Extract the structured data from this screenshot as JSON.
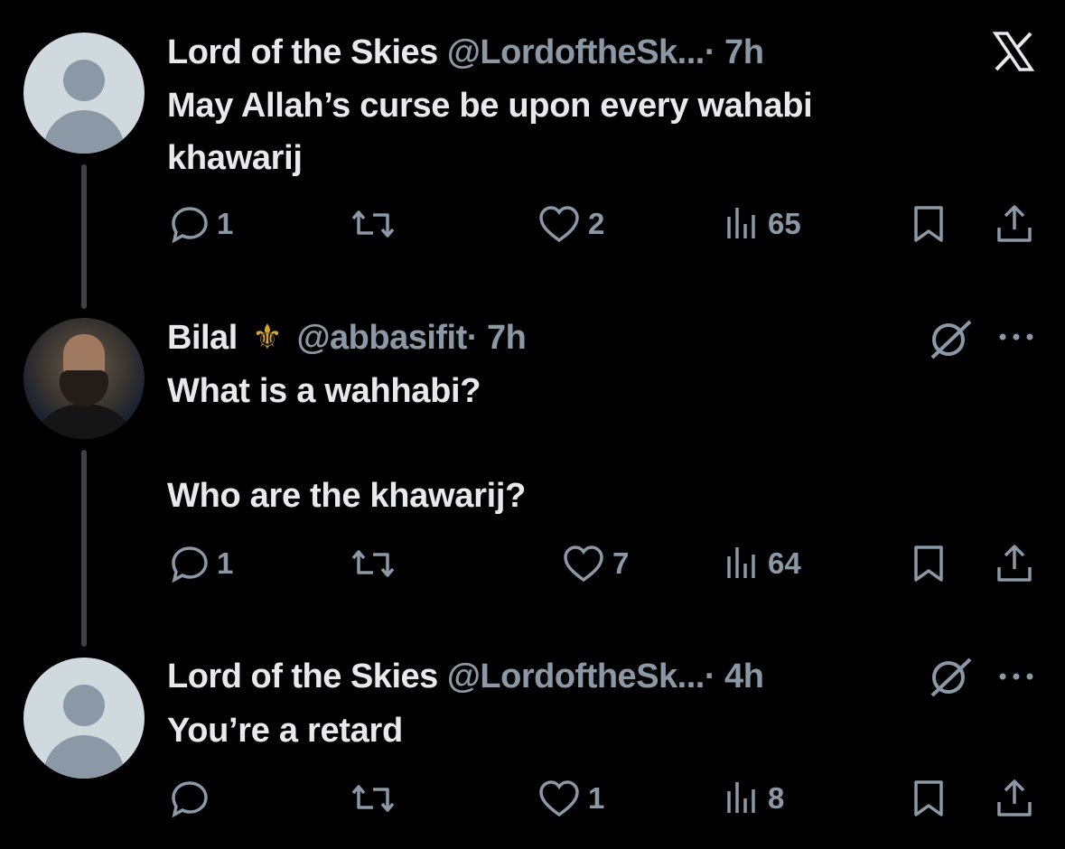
{
  "tweets": [
    {
      "name": "Lord of the Skies",
      "handle": "@LordoftheSk...",
      "time": "· 7h",
      "text_lines": [
        "May Allah’s curse be upon every wahabi",
        "khawarij"
      ],
      "replies": "1",
      "likes": "2",
      "views": "65"
    },
    {
      "name": "Bilal",
      "badge": "⚜",
      "handle": "@abbasifit",
      "time": "· 7h",
      "text_lines": [
        "What is a wahhabi?",
        "",
        "Who are the khawarij?"
      ],
      "replies": "1",
      "likes": "7",
      "views": "64"
    },
    {
      "name": "Lord of the Skies",
      "handle": "@LordoftheSk...",
      "time": "· 4h",
      "text_lines": [
        "You’re a retard"
      ],
      "replies": "",
      "likes": "1",
      "views": "8"
    }
  ],
  "icons": {
    "logo": "x-logo-icon",
    "reply": "reply-icon",
    "retweet": "retweet-icon",
    "like": "heart-icon",
    "views": "views-icon",
    "bookmark": "bookmark-icon",
    "share": "share-icon",
    "grok": "grok-icon",
    "more": "more-icon"
  },
  "colors": {
    "background": "#000000",
    "primary_text": "#e7e9ea",
    "secondary_text": "#8b98a5"
  }
}
